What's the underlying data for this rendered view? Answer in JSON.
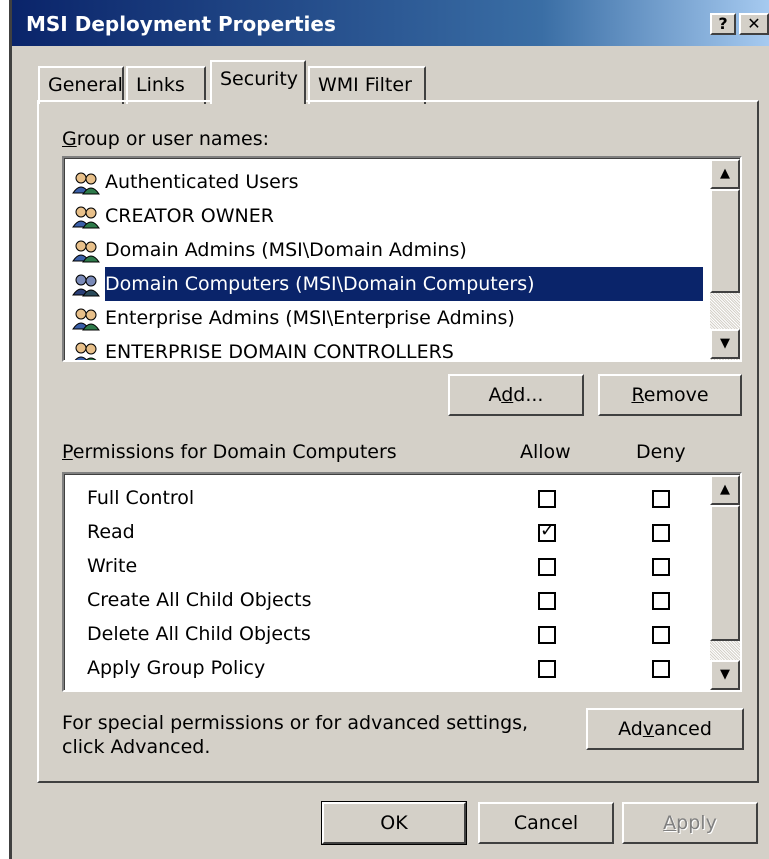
{
  "window": {
    "title": "MSI Deployment Properties",
    "help_label": "?",
    "close_label": "✕"
  },
  "tabs": [
    {
      "label": "General",
      "active": false
    },
    {
      "label": "Links",
      "active": false
    },
    {
      "label": "Security",
      "active": true
    },
    {
      "label": "WMI Filter",
      "active": false
    }
  ],
  "groups": {
    "label_prefix": "G",
    "label_rest": "roup or user names:",
    "items": [
      {
        "name": "Authenticated Users",
        "selected": false
      },
      {
        "name": "CREATOR OWNER",
        "selected": false
      },
      {
        "name": "Domain Admins (MSI\\Domain Admins)",
        "selected": false
      },
      {
        "name": "Domain Computers (MSI\\Domain Computers)",
        "selected": true
      },
      {
        "name": "Enterprise Admins (MSI\\Enterprise Admins)",
        "selected": false
      },
      {
        "name": "ENTERPRISE DOMAIN CONTROLLERS",
        "selected": false
      }
    ]
  },
  "buttons": {
    "add_pre": "A",
    "add_u": "d",
    "add_post": "d...",
    "remove_u": "R",
    "remove_post": "emove",
    "advanced_pre": "Ad",
    "advanced_u": "v",
    "advanced_post": "anced",
    "ok": "OK",
    "cancel": "Cancel",
    "apply_u": "A",
    "apply_post": "pply"
  },
  "permissions": {
    "label_u": "P",
    "label_rest": "ermissions for Domain Computers",
    "allow_header": "Allow",
    "deny_header": "Deny",
    "items": [
      {
        "name": "Full Control",
        "allow": false,
        "deny": false
      },
      {
        "name": "Read",
        "allow": true,
        "deny": false
      },
      {
        "name": "Write",
        "allow": false,
        "deny": false
      },
      {
        "name": "Create All Child Objects",
        "allow": false,
        "deny": false
      },
      {
        "name": "Delete All Child Objects",
        "allow": false,
        "deny": false
      },
      {
        "name": "Apply Group Policy",
        "allow": false,
        "deny": false
      }
    ]
  },
  "advanced_hint": {
    "line1": "For special permissions or for advanced settings,",
    "line2": "click Advanced."
  },
  "colors": {
    "face": "#d4d0c8",
    "selection": "#0a246a",
    "title_start": "#0a246a"
  }
}
